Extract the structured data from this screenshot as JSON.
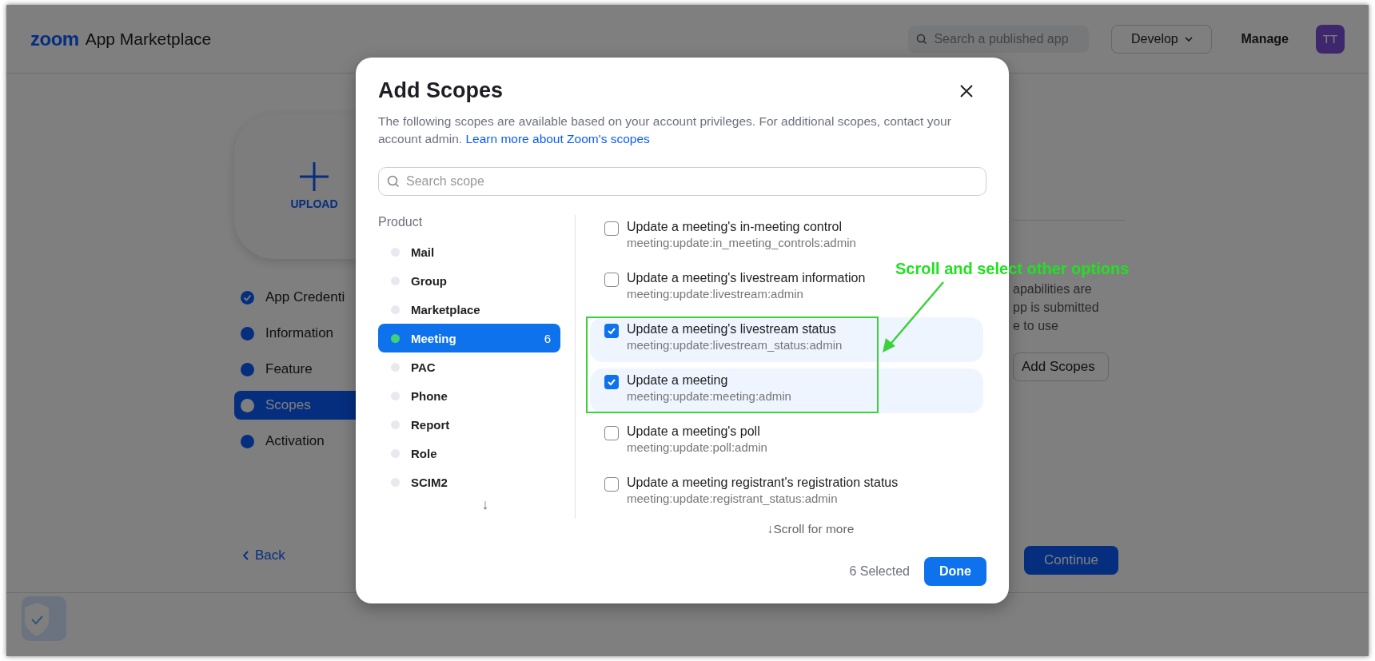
{
  "header": {
    "logo": "zoom",
    "title": "App Marketplace",
    "search": {
      "placeholder": "Search a published app"
    },
    "develop": "Develop",
    "manage": "Manage",
    "avatar": "TT"
  },
  "upload": {
    "label": "UPLOAD"
  },
  "steps": [
    {
      "label": "App Credenti",
      "completed": true,
      "selected": false
    },
    {
      "label": "Information",
      "completed": false,
      "selected": false
    },
    {
      "label": "Feature",
      "completed": false,
      "selected": false
    },
    {
      "label": "Scopes",
      "completed": false,
      "selected": true
    },
    {
      "label": "Activation",
      "completed": false,
      "selected": false
    }
  ],
  "info_text": [
    "apabilities are",
    "pp is submitted",
    "e to use"
  ],
  "add_scopes_button": "Add Scopes",
  "back": "Back",
  "continue": "Continue",
  "dialog": {
    "title": "Add Scopes",
    "description": "The following scopes are available based on your account privileges. For additional scopes, contact your account admin.",
    "link": "Learn more about Zoom's scopes",
    "search": {
      "placeholder": "Search scope"
    },
    "product_label": "Product",
    "products": [
      {
        "name": "Mail",
        "selected": false
      },
      {
        "name": "Group",
        "selected": false
      },
      {
        "name": "Marketplace",
        "selected": false
      },
      {
        "name": "Meeting",
        "selected": true,
        "count": "6"
      },
      {
        "name": "PAC",
        "selected": false
      },
      {
        "name": "Phone",
        "selected": false
      },
      {
        "name": "Report",
        "selected": false
      },
      {
        "name": "Role",
        "selected": false
      },
      {
        "name": "SCIM2",
        "selected": false
      }
    ],
    "products_more": "↓",
    "scopes": [
      {
        "title": "Update a meeting's in-meeting control",
        "code": "meeting:update:in_meeting_controls:admin",
        "checked": false
      },
      {
        "title": "Update a meeting's livestream information",
        "code": "meeting:update:livestream:admin",
        "checked": false
      },
      {
        "title": "Update a meeting's livestream status",
        "code": "meeting:update:livestream_status:admin",
        "checked": true
      },
      {
        "title": "Update a meeting",
        "code": "meeting:update:meeting:admin",
        "checked": true
      },
      {
        "title": "Update a meeting's poll",
        "code": "meeting:update:poll:admin",
        "checked": false
      },
      {
        "title": "Update a meeting registrant's registration status",
        "code": "meeting:update:registrant_status:admin",
        "checked": false
      }
    ],
    "scroll_hint": "↓Scroll for more",
    "selected_count": "6 Selected",
    "done": "Done"
  },
  "annotation": {
    "text": "Scroll and select other options"
  }
}
